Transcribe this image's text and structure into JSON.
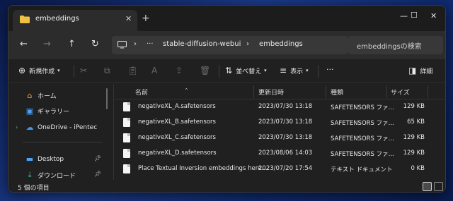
{
  "window": {
    "tab_title": "embeddings",
    "tab_close": "✕",
    "new_tab": "+",
    "controls": {
      "minimize": "—",
      "maximize": "☐",
      "close": "✕"
    }
  },
  "nav": {
    "back": "←",
    "forward": "→",
    "up": "↑",
    "refresh": "↻",
    "breadcrumb": [
      "stable-diffusion-webui",
      "embeddings"
    ],
    "breadcrumb_more": "···",
    "separator": "›",
    "search_placeholder": "embeddingsの検索"
  },
  "toolbar": {
    "new_label": "新規作成",
    "sort_label": "並べ替え",
    "view_label": "表示",
    "more_label": "···",
    "details_label": "詳細"
  },
  "sidebar": {
    "items": [
      {
        "label": "ホーム",
        "icon": "home-icon"
      },
      {
        "label": "ギャラリー",
        "icon": "gallery-icon"
      },
      {
        "label": "OneDrive - iPentec",
        "icon": "cloud-icon"
      },
      {
        "label": "Desktop",
        "icon": "desktop-icon"
      },
      {
        "label": "ダウンロード",
        "icon": "download-icon"
      }
    ]
  },
  "columns": [
    "名前",
    "更新日時",
    "種類",
    "サイズ"
  ],
  "files": [
    {
      "name": "negativeXL_A.safetensors",
      "modified": "2023/07/30 13:18",
      "type": "SAFETENSORS ファ...",
      "size": "129 KB"
    },
    {
      "name": "negativeXL_B.safetensors",
      "modified": "2023/07/30 13:18",
      "type": "SAFETENSORS ファ...",
      "size": "65 KB"
    },
    {
      "name": "negativeXL_C.safetensors",
      "modified": "2023/07/30 13:18",
      "type": "SAFETENSORS ファ...",
      "size": "129 KB"
    },
    {
      "name": "negativeXL_D.safetensors",
      "modified": "2023/08/06 14:03",
      "type": "SAFETENSORS ファ...",
      "size": "129 KB"
    },
    {
      "name": "Place Textual Inversion embeddings here....",
      "modified": "2023/07/20 17:54",
      "type": "テキスト ドキュメント",
      "size": "0 KB"
    }
  ],
  "status": {
    "count": "5 個の項目"
  },
  "colors": {
    "accent_folder": "#f0c040",
    "window_bg": "#202020",
    "toolbar_bg": "#2c2c2c"
  }
}
